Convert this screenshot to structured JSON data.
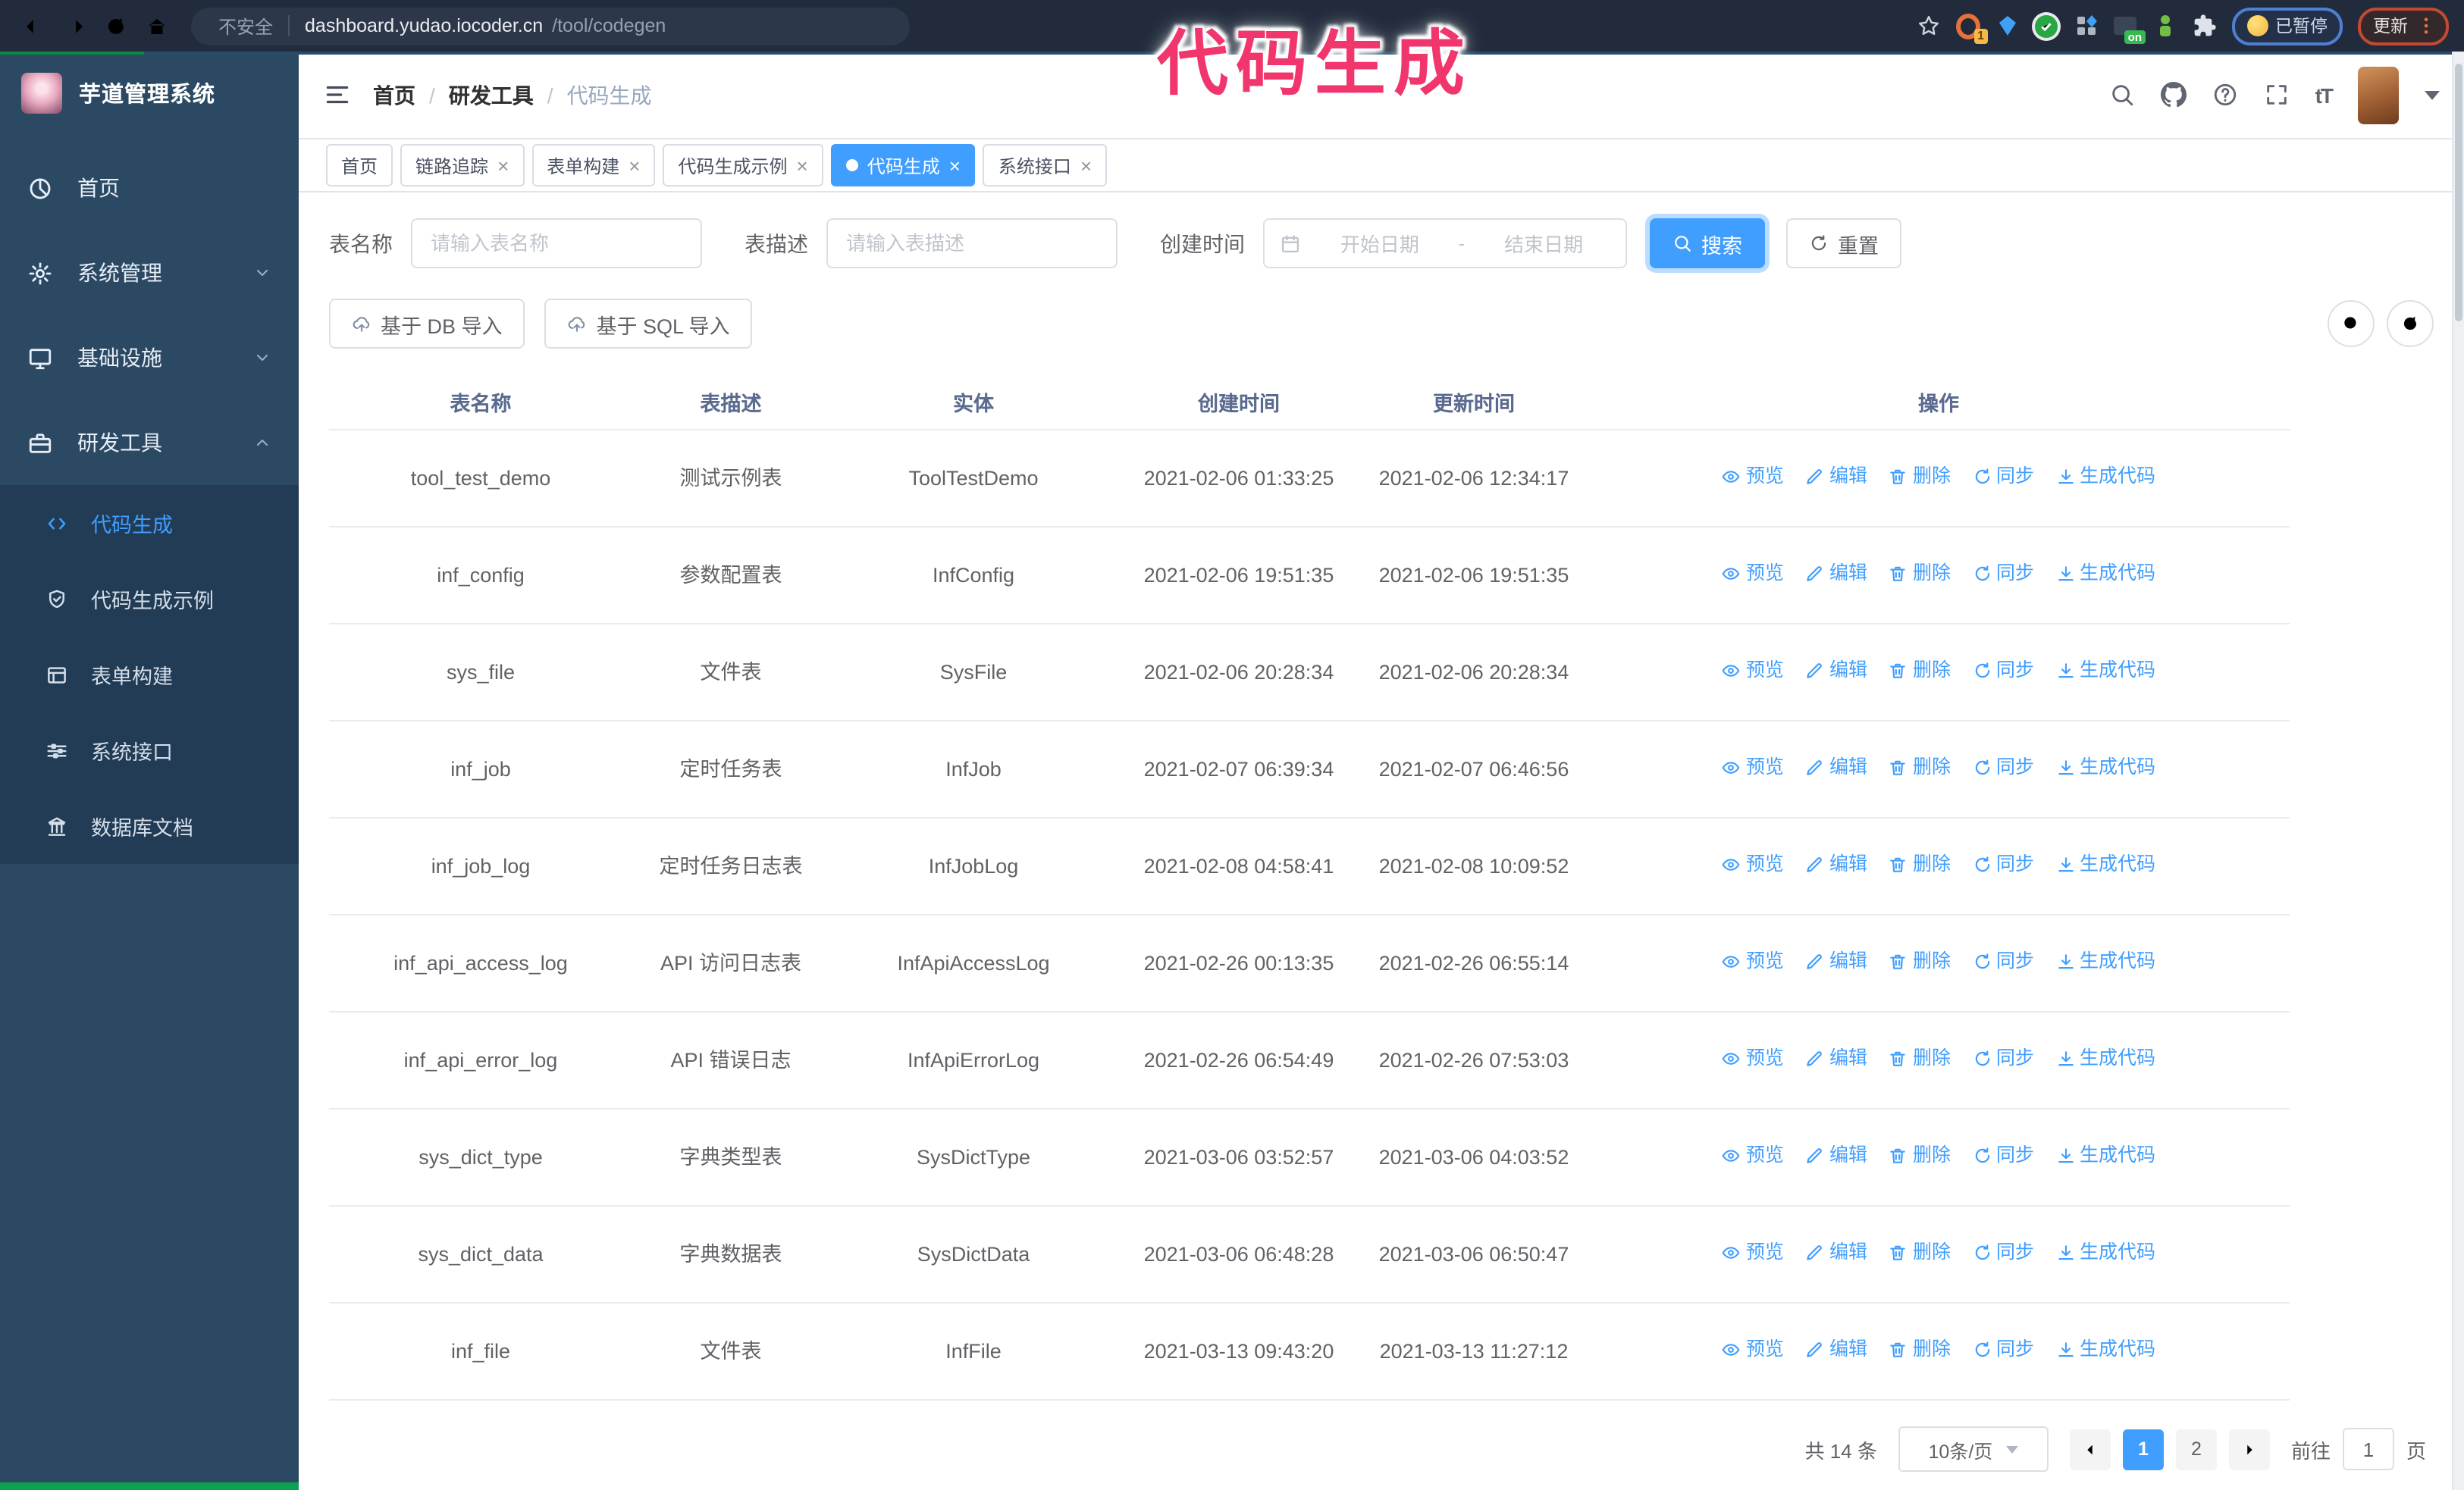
{
  "browser": {
    "security_label": "不安全",
    "url_host": "dashboard.yudao.iocoder.cn",
    "url_path": "/tool/codegen",
    "extension_counter_badge": "1",
    "extension_on_badge": "on",
    "paused_badge": "已暂停",
    "update_label": "更新"
  },
  "overlay_title": "代码生成",
  "sidebar": {
    "app_title": "芋道管理系统",
    "menu": [
      {
        "key": "home",
        "label": "首页",
        "icon": "dashboard-icon",
        "state": "none",
        "active": false
      },
      {
        "key": "system",
        "label": "系统管理",
        "icon": "gear-icon",
        "state": "collapsed",
        "active": false
      },
      {
        "key": "infra",
        "label": "基础设施",
        "icon": "monitor-icon",
        "state": "collapsed",
        "active": false
      },
      {
        "key": "dev-tools",
        "label": "研发工具",
        "icon": "toolbox-icon",
        "state": "expanded",
        "active": false,
        "children": [
          {
            "key": "codegen",
            "label": "代码生成",
            "icon": "code-icon",
            "active": true
          },
          {
            "key": "codegen-example",
            "label": "代码生成示例",
            "icon": "shield-check-icon",
            "active": false
          },
          {
            "key": "form-builder",
            "label": "表单构建",
            "icon": "form-icon",
            "active": false
          },
          {
            "key": "system-api",
            "label": "系统接口",
            "icon": "sliders-icon",
            "active": false
          },
          {
            "key": "db-doc",
            "label": "数据库文档",
            "icon": "database-icon",
            "active": false
          }
        ]
      }
    ]
  },
  "header": {
    "breadcrumb": [
      {
        "key": "home",
        "label": "首页",
        "current": false
      },
      {
        "key": "dev-tools",
        "label": "研发工具",
        "current": false
      },
      {
        "key": "codegen",
        "label": "代码生成",
        "current": true
      }
    ]
  },
  "tabs": [
    {
      "key": "home",
      "label": "首页",
      "closable": false,
      "active": false
    },
    {
      "key": "tracer",
      "label": "链路追踪",
      "closable": true,
      "active": false
    },
    {
      "key": "form-builder",
      "label": "表单构建",
      "closable": true,
      "active": false
    },
    {
      "key": "codegen-example",
      "label": "代码生成示例",
      "closable": true,
      "active": false
    },
    {
      "key": "codegen",
      "label": "代码生成",
      "closable": true,
      "active": true
    },
    {
      "key": "system-api",
      "label": "系统接口",
      "closable": true,
      "active": false
    }
  ],
  "filters": {
    "table_name_label": "表名称",
    "table_name_placeholder": "请输入表名称",
    "table_desc_label": "表描述",
    "table_desc_placeholder": "请输入表描述",
    "create_time_label": "创建时间",
    "start_date_placeholder": "开始日期",
    "range_separator": "-",
    "end_date_placeholder": "结束日期",
    "search_label": "搜索",
    "reset_label": "重置"
  },
  "toolbar": {
    "import_db_label": "基于 DB 导入",
    "import_sql_label": "基于 SQL 导入"
  },
  "table": {
    "columns": [
      "表名称",
      "表描述",
      "实体",
      "创建时间",
      "更新时间",
      "操作"
    ],
    "actions": [
      {
        "key": "preview",
        "label": "预览",
        "icon": "eye-icon"
      },
      {
        "key": "edit",
        "label": "编辑",
        "icon": "edit-icon"
      },
      {
        "key": "delete",
        "label": "删除",
        "icon": "delete-icon"
      },
      {
        "key": "sync",
        "label": "同步",
        "icon": "sync-icon"
      },
      {
        "key": "generate",
        "label": "生成代码",
        "icon": "download-icon"
      }
    ],
    "rows": [
      {
        "name": "tool_test_demo",
        "desc": "测试示例表",
        "entity": "ToolTestDemo",
        "created": "2021-02-06 01:33:25",
        "updated": "2021-02-06 12:34:17"
      },
      {
        "name": "inf_config",
        "desc": "参数配置表",
        "entity": "InfConfig",
        "created": "2021-02-06 19:51:35",
        "updated": "2021-02-06 19:51:35"
      },
      {
        "name": "sys_file",
        "desc": "文件表",
        "entity": "SysFile",
        "created": "2021-02-06 20:28:34",
        "updated": "2021-02-06 20:28:34"
      },
      {
        "name": "inf_job",
        "desc": "定时任务表",
        "entity": "InfJob",
        "created": "2021-02-07 06:39:34",
        "updated": "2021-02-07 06:46:56"
      },
      {
        "name": "inf_job_log",
        "desc": "定时任务日志表",
        "entity": "InfJobLog",
        "created": "2021-02-08 04:58:41",
        "updated": "2021-02-08 10:09:52"
      },
      {
        "name": "inf_api_access_log",
        "desc": "API 访问日志表",
        "entity": "InfApiAccessLog",
        "created": "2021-02-26 00:13:35",
        "updated": "2021-02-26 06:55:14"
      },
      {
        "name": "inf_api_error_log",
        "desc": "API 错误日志",
        "entity": "InfApiErrorLog",
        "created": "2021-02-26 06:54:49",
        "updated": "2021-02-26 07:53:03"
      },
      {
        "name": "sys_dict_type",
        "desc": "字典类型表",
        "entity": "SysDictType",
        "created": "2021-03-06 03:52:57",
        "updated": "2021-03-06 04:03:52"
      },
      {
        "name": "sys_dict_data",
        "desc": "字典数据表",
        "entity": "SysDictData",
        "created": "2021-03-06 06:48:28",
        "updated": "2021-03-06 06:50:47"
      },
      {
        "name": "inf_file",
        "desc": "文件表",
        "entity": "InfFile",
        "created": "2021-03-13 09:43:20",
        "updated": "2021-03-13 11:27:12"
      }
    ]
  },
  "pagination": {
    "total_label": "共 14 条",
    "page_size_label": "10条/页",
    "pages": [
      "1",
      "2"
    ],
    "active_page": "1",
    "goto_label": "前往",
    "goto_value": "1",
    "page_unit_label": "页"
  },
  "colors": {
    "accent_blue": "#409eff",
    "overlay_pink": "#f1356d",
    "sidebar_bg": "#2c4964",
    "submenu_bg": "#223c55",
    "chrome_bg": "#212b3b",
    "green_bar": "#0ca24f"
  }
}
